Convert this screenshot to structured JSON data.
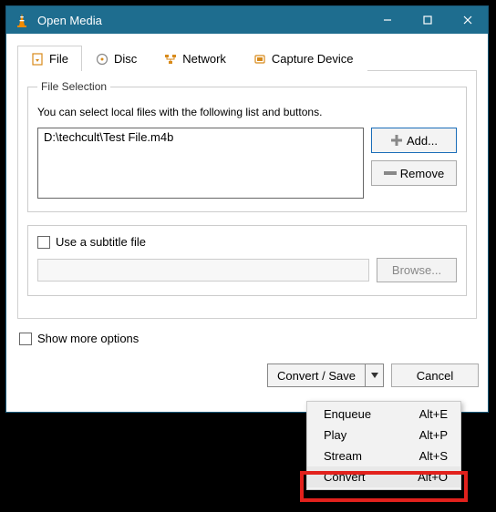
{
  "titlebar": {
    "title": "Open Media"
  },
  "tabs": {
    "file": "File",
    "disc": "Disc",
    "network": "Network",
    "capture": "Capture Device"
  },
  "fileSelection": {
    "legend": "File Selection",
    "hint": "You can select local files with the following list and buttons.",
    "entry": "D:\\techcult\\Test File.m4b",
    "add": "Add...",
    "remove": "Remove"
  },
  "subtitle": {
    "label": "Use a subtitle file",
    "browse": "Browse..."
  },
  "showMore": "Show more options",
  "footer": {
    "convertSave": "Convert / Save",
    "cancel": "Cancel"
  },
  "menu": {
    "items": [
      {
        "label": "Enqueue",
        "shortcut": "Alt+E"
      },
      {
        "label": "Play",
        "shortcut": "Alt+P"
      },
      {
        "label": "Stream",
        "shortcut": "Alt+S"
      },
      {
        "label": "Convert",
        "shortcut": "Alt+O"
      }
    ]
  }
}
